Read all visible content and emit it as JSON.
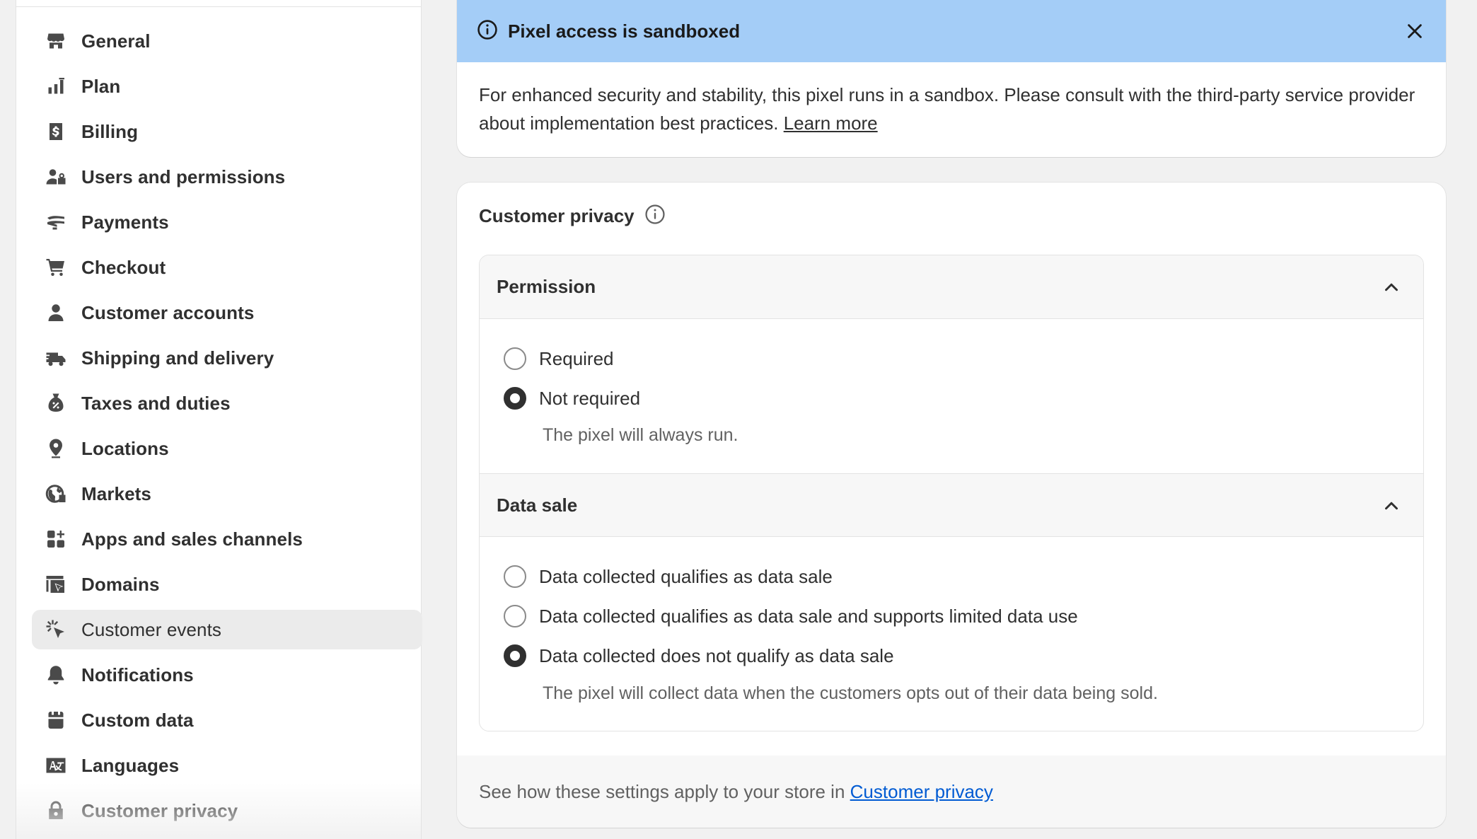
{
  "sidebar": {
    "items": [
      {
        "label": "General",
        "icon": "store-icon"
      },
      {
        "label": "Plan",
        "icon": "plan-icon"
      },
      {
        "label": "Billing",
        "icon": "billing-icon"
      },
      {
        "label": "Users and permissions",
        "icon": "users-icon"
      },
      {
        "label": "Payments",
        "icon": "payments-icon"
      },
      {
        "label": "Checkout",
        "icon": "cart-icon"
      },
      {
        "label": "Customer accounts",
        "icon": "person-icon"
      },
      {
        "label": "Shipping and delivery",
        "icon": "truck-icon"
      },
      {
        "label": "Taxes and duties",
        "icon": "tax-icon"
      },
      {
        "label": "Locations",
        "icon": "location-pin-icon"
      },
      {
        "label": "Markets",
        "icon": "globe-icon"
      },
      {
        "label": "Apps and sales channels",
        "icon": "apps-icon"
      },
      {
        "label": "Domains",
        "icon": "domains-icon"
      },
      {
        "label": "Customer events",
        "icon": "cursor-click-icon",
        "active": true
      },
      {
        "label": "Notifications",
        "icon": "bell-icon"
      },
      {
        "label": "Custom data",
        "icon": "custom-data-icon"
      },
      {
        "label": "Languages",
        "icon": "language-icon"
      },
      {
        "label": "Customer privacy",
        "icon": "lock-icon"
      }
    ]
  },
  "banner": {
    "title": "Pixel access is sandboxed",
    "body": "For enhanced security and stability, this pixel runs in a sandbox. Please consult with the third-party service provider about implementation best practices.",
    "link": "Learn more"
  },
  "privacy": {
    "title": "Customer privacy",
    "permission": {
      "title": "Permission",
      "options": [
        "Required",
        "Not required"
      ],
      "selected": "Not required",
      "help": "The pixel will always run."
    },
    "data_sale": {
      "title": "Data sale",
      "options": [
        "Data collected qualifies as data sale",
        "Data collected qualifies as data sale and supports limited data use",
        "Data collected does not qualify as data sale"
      ],
      "selected": "Data collected does not qualify as data sale",
      "help": "The pixel will collect data when the customers opts out of their data being sold."
    },
    "footer": {
      "text": "See how these settings apply to your store in",
      "link": "Customer privacy"
    }
  },
  "colors": {
    "banner_bg": "#a4cdf7",
    "link_blue": "#005bd3",
    "active_item_bg": "#ebebeb"
  }
}
